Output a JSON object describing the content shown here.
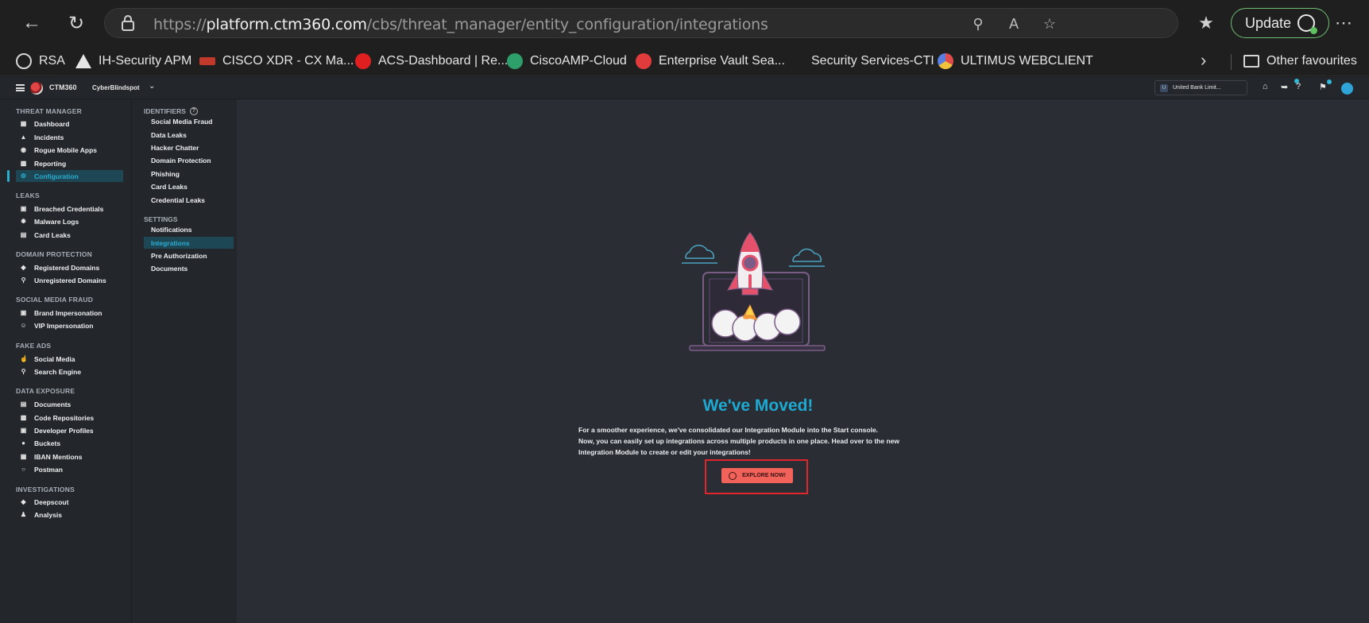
{
  "browser": {
    "url_scheme": "https://",
    "url_host": "platform.ctm360.com",
    "url_path": "/cbs/threat_manager/entity_configuration/integrations",
    "update_label": "Update",
    "bookmarks": [
      {
        "label": "RSA",
        "icon": "globe-icon",
        "color": "#d6d6d6"
      },
      {
        "label": "IH-Security APM",
        "icon": "triangle-icon",
        "color": "#111111"
      },
      {
        "label": "CISCO XDR - CX Ma...",
        "icon": "cisco-icon",
        "color": "#c0392b"
      },
      {
        "label": "ACS-Dashboard | Re...",
        "icon": "redhat-icon",
        "color": "#e02020"
      },
      {
        "label": "CiscoAMP-Cloud",
        "icon": "amp-icon",
        "color": "#2e9e6a"
      },
      {
        "label": "Enterprise Vault Sea...",
        "icon": "vault-icon",
        "color": "#e23b3b"
      },
      {
        "label": "Security Services-CTI",
        "icon": "",
        "color": ""
      },
      {
        "label": "ULTIMUS WEBCLIENT",
        "icon": "ultimus-icon",
        "color": "#5a7de0"
      }
    ],
    "other_favourites": "Other favourites"
  },
  "app": {
    "brand": "CTM360",
    "workspace": "CyberBlindspot",
    "org": "United Bank Limit...",
    "org_initial": "U",
    "accent": "#2aaed0"
  },
  "sidebar": {
    "sections": [
      {
        "title": "THREAT MANAGER",
        "items": [
          {
            "label": "Dashboard",
            "icon": "dashboard-icon"
          },
          {
            "label": "Incidents",
            "icon": "warning-icon"
          },
          {
            "label": "Rogue Mobile Apps",
            "icon": "android-icon"
          },
          {
            "label": "Reporting",
            "icon": "report-icon"
          },
          {
            "label": "Configuration",
            "icon": "gear-icon",
            "active": true
          }
        ]
      },
      {
        "title": "LEAKS",
        "items": [
          {
            "label": "Breached Credentials",
            "icon": "lock-icon"
          },
          {
            "label": "Malware Logs",
            "icon": "bug-icon"
          },
          {
            "label": "Card Leaks",
            "icon": "card-icon"
          }
        ]
      },
      {
        "title": "DOMAIN PROTECTION",
        "items": [
          {
            "label": "Registered Domains",
            "icon": "shield-icon"
          },
          {
            "label": "Unregistered Domains",
            "icon": "search-icon"
          }
        ]
      },
      {
        "title": "SOCIAL MEDIA FRAUD",
        "items": [
          {
            "label": "Brand Impersonation",
            "icon": "lock-icon"
          },
          {
            "label": "VIP Impersonation",
            "icon": "user-icon"
          }
        ]
      },
      {
        "title": "FAKE ADS",
        "items": [
          {
            "label": "Social Media",
            "icon": "thumbs-up-icon"
          },
          {
            "label": "Search Engine",
            "icon": "search-user-icon"
          }
        ]
      },
      {
        "title": "DATA EXPOSURE",
        "items": [
          {
            "label": "Documents",
            "icon": "document-icon"
          },
          {
            "label": "Code Repositories",
            "icon": "code-icon"
          },
          {
            "label": "Developer Profiles",
            "icon": "profile-icon"
          },
          {
            "label": "Buckets",
            "icon": "bucket-icon"
          },
          {
            "label": "IBAN Mentions",
            "icon": "bank-icon"
          },
          {
            "label": "Postman",
            "icon": "postman-icon"
          }
        ]
      },
      {
        "title": "INVESTIGATIONS",
        "items": [
          {
            "label": "Deepscout",
            "icon": "shield-icon"
          },
          {
            "label": "Analysis",
            "icon": "person-icon"
          }
        ]
      }
    ]
  },
  "subnav": {
    "identifiers_title": "IDENTIFIERS",
    "identifiers": [
      "Social Media Fraud",
      "Data Leaks",
      "Hacker Chatter",
      "Domain Protection",
      "Phishing",
      "Card Leaks",
      "Credential Leaks"
    ],
    "settings_title": "SETTINGS",
    "settings": [
      "Notifications",
      "Integrations",
      "Pre Authorization",
      "Documents"
    ],
    "active": "Integrations"
  },
  "main": {
    "title": "We've Moved!",
    "line1": "For a smoother experience, we've consolidated our Integration Module into the Start console.",
    "line2": "Now, you can easily set up integrations across multiple products in one place. Head over to the new",
    "line3": "Integration Module to create or edit your integrations!",
    "button_label": "EXPLORE NOW!",
    "button_color": "#f0625a",
    "highlight_color": "#e0262b"
  }
}
